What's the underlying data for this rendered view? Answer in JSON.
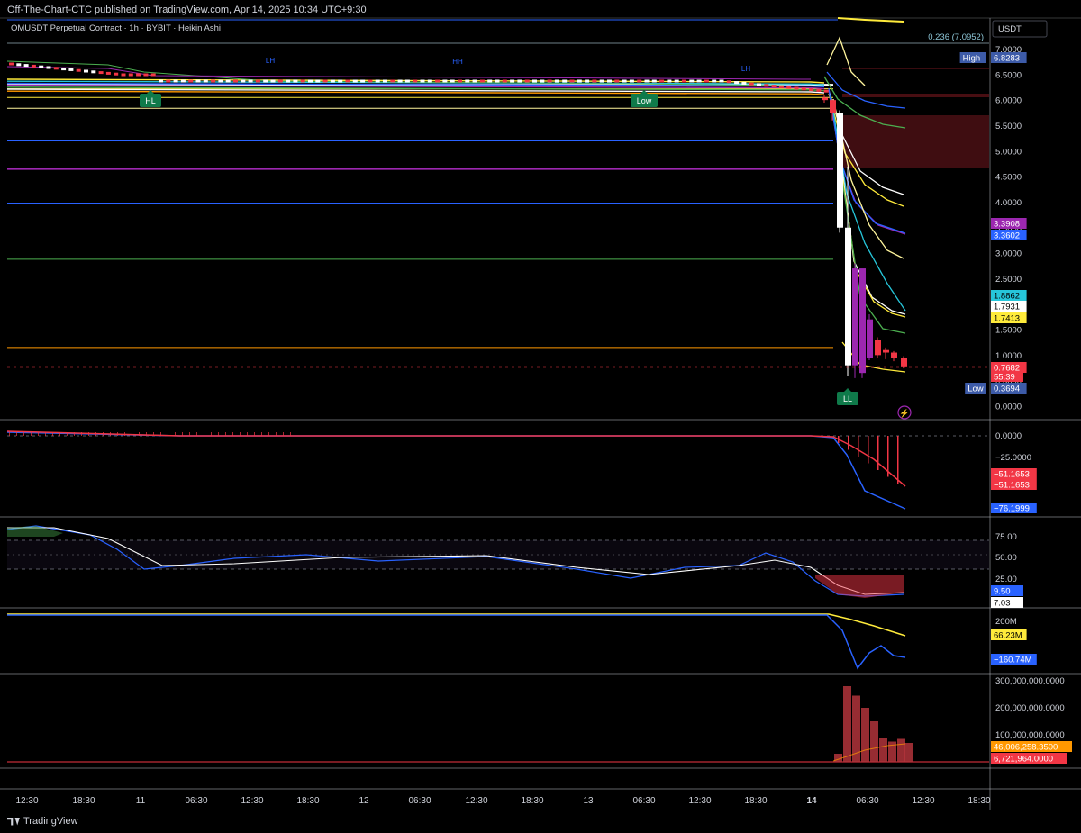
{
  "header": {
    "published": "Off-The-Chart-CTC published on TradingView.com, Apr 14, 2025 10:34 UTC+9:30"
  },
  "footer": {
    "brand": "TradingView"
  },
  "colors": {
    "background": "#000000",
    "text": "#d1d4dc",
    "bull": "#ffffff",
    "bear": "#f23645",
    "purple": "#9c27b0",
    "blue": "#2962ff",
    "yellow": "#ffeb3b",
    "green": "#4caf50",
    "orange": "#ff9800"
  },
  "chart_data": [
    {
      "type": "line",
      "role": "price",
      "title": "OMUSDT Perpetual Contract · 1h · BYBIT · Heikin Ashi",
      "axis_unit": "USDT",
      "ylim": [
        0,
        7.2
      ],
      "y_ticks": [
        "7.0000",
        "6.5000",
        "6.0000",
        "5.5000",
        "5.0000",
        "4.5000",
        "4.0000",
        "3.5000",
        "3.0000",
        "2.5000",
        "2.0000",
        "1.5000",
        "1.0000",
        "0.5000",
        "0.0000"
      ],
      "y_tick_values": [
        7.0,
        6.5,
        6.0,
        5.5,
        5.0,
        4.5,
        4.0,
        3.5,
        3.0,
        2.5,
        2.0,
        1.5,
        1.0,
        0.5,
        0.0
      ],
      "x_ticks": [
        "12:30",
        "18:30",
        "11",
        "06:30",
        "12:30",
        "18:30",
        "12",
        "06:30",
        "12:30",
        "18:30",
        "13",
        "06:30",
        "12:30",
        "18:30",
        "14",
        "06:30",
        "12:30",
        "18:30"
      ],
      "fib_label": "0.236 (7.0952)",
      "price_tags": [
        {
          "label": "High",
          "value": "6.8283",
          "color": "#3d5ba8"
        },
        {
          "label": "",
          "value": "3.3908",
          "color": "#9c27b0"
        },
        {
          "label": "",
          "value": "3.3602",
          "color": "#2962ff"
        },
        {
          "label": "",
          "value": "1.8862",
          "color": "#26c6da"
        },
        {
          "label": "",
          "value": "1.7931",
          "color": "#ffffff"
        },
        {
          "label": "",
          "value": "1.7413",
          "color": "#ffeb3b"
        },
        {
          "label": "",
          "value": "0.7682",
          "color": "#f23645"
        },
        {
          "label": "",
          "value": "55:39",
          "color": "#f23645"
        },
        {
          "label": "Low",
          "value": "0.3694",
          "color": "#3d5ba8"
        }
      ],
      "markers": [
        {
          "text": "HL",
          "color": "#0f7a4a"
        },
        {
          "text": "Low",
          "color": "#0f7a4a"
        },
        {
          "text": "LL",
          "color": "#0f7a4a"
        },
        {
          "text": "LH",
          "color": "#2962ff"
        },
        {
          "text": "HH",
          "color": "#2962ff"
        },
        {
          "text": "LH",
          "color": "#2962ff"
        }
      ],
      "levels": [
        {
          "value": 6.3,
          "color": "#ffffff"
        },
        {
          "value": 6.22,
          "color": "#ffeb3b"
        },
        {
          "value": 6.05,
          "color": "#ffeb3b"
        },
        {
          "value": 5.84,
          "color": "#fff59d"
        },
        {
          "value": 5.2,
          "color": "#2962ff"
        },
        {
          "value": 4.65,
          "color": "#9c27b0"
        },
        {
          "value": 3.98,
          "color": "#2962ff"
        },
        {
          "value": 2.88,
          "color": "#4caf50"
        },
        {
          "value": 1.15,
          "color": "#ff9800"
        }
      ],
      "current_price": 0.7682,
      "candles_tail": [
        {
          "o": 6.05,
          "h": 6.1,
          "l": 5.95,
          "c": 6.0
        },
        {
          "o": 6.0,
          "h": 6.02,
          "l": 5.6,
          "c": 5.75
        },
        {
          "o": 5.75,
          "h": 5.8,
          "l": 3.4,
          "c": 3.5
        },
        {
          "o": 3.5,
          "h": 4.7,
          "l": 0.6,
          "c": 0.8
        },
        {
          "o": 0.8,
          "h": 2.8,
          "l": 0.55,
          "c": 2.7
        },
        {
          "o": 2.7,
          "h": 1.9,
          "l": 0.55,
          "c": 0.65
        },
        {
          "o": 1.7,
          "h": 1.8,
          "l": 0.9,
          "c": 0.95
        },
        {
          "o": 1.3,
          "h": 1.35,
          "l": 0.95,
          "c": 1.0
        },
        {
          "o": 1.1,
          "h": 1.15,
          "l": 0.92,
          "c": 1.05
        },
        {
          "o": 1.05,
          "h": 1.08,
          "l": 0.88,
          "c": 0.95
        },
        {
          "o": 0.95,
          "h": 0.98,
          "l": 0.74,
          "c": 0.78
        }
      ]
    },
    {
      "type": "bar",
      "role": "macd",
      "y_ticks": [
        "0.0000",
        "−25.0000"
      ],
      "tags": [
        {
          "value": "−51.1653",
          "color": "#f23645"
        },
        {
          "value": "−51.1653",
          "color": "#f23645"
        },
        {
          "value": "−76.1999",
          "color": "#2962ff"
        }
      ]
    },
    {
      "type": "line",
      "role": "rsi",
      "y_ticks": [
        "75.00",
        "50.00",
        "25.00"
      ],
      "tags": [
        {
          "value": "9.50",
          "color": "#2962ff"
        },
        {
          "value": "7.03",
          "color": "#ffffff"
        }
      ]
    },
    {
      "type": "line",
      "role": "volume-flow",
      "y_ticks": [
        "200M"
      ],
      "tags": [
        {
          "value": "66.23M",
          "color": "#ffeb3b"
        },
        {
          "value": "−160.74M",
          "color": "#2962ff"
        }
      ]
    },
    {
      "type": "bar",
      "role": "volume",
      "y_ticks": [
        "300,000,000.0000",
        "200,000,000.0000",
        "100,000,000.0000"
      ],
      "y_tick_values": [
        300000000,
        200000000,
        100000000
      ],
      "ylim": [
        0,
        330000000
      ],
      "values_tail": [
        30000000,
        280000000,
        245000000,
        200000000,
        150000000,
        90000000,
        75000000,
        85000000,
        70000000
      ],
      "tags": [
        {
          "value": "46,006,258.3500",
          "color": "#ff9800"
        },
        {
          "value": "6,721,964.0000",
          "color": "#f23645"
        }
      ]
    }
  ]
}
